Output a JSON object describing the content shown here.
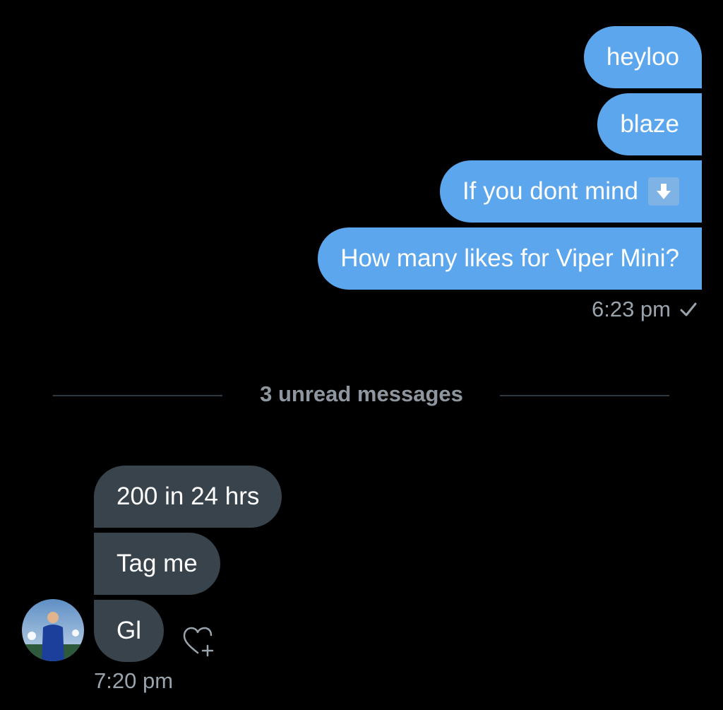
{
  "colors": {
    "background": "#000000",
    "sent_bubble": "#5ba6ec",
    "received_bubble": "#39434b",
    "meta_text": "#9aa4ad"
  },
  "sent_messages": [
    {
      "text": "heyloo"
    },
    {
      "text": "blaze"
    },
    {
      "text": "If you dont mind",
      "emoji": "down-arrow-emoji"
    },
    {
      "text": "How many likes for Viper Mini?"
    }
  ],
  "sent_time": "6:23 pm",
  "sent_status_icon": "check-icon",
  "unread_divider": "3 unread messages",
  "received_messages": [
    {
      "text": "200 in 24 hrs"
    },
    {
      "text": "Tag me"
    },
    {
      "text": "Gl"
    }
  ],
  "received_time": "7:20 pm",
  "reaction_icon": "heart-plus-icon",
  "avatar_icon": "user-avatar"
}
